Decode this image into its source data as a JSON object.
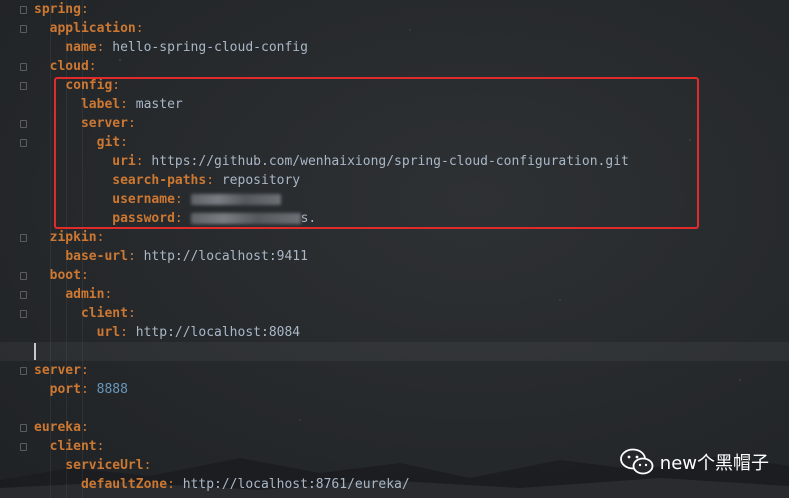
{
  "yaml": {
    "spring_key": "spring",
    "application_key": "application",
    "name_key": "name",
    "name_value": "hello-spring-cloud-config",
    "cloud_key": "cloud",
    "config_key": "config",
    "label_key": "label",
    "label_value": "master",
    "server_key": "server",
    "git_key": "git",
    "uri_key": "uri",
    "uri_value": "https://github.com/wenhaixiong/spring-cloud-configuration.git",
    "search_paths_key": "search-paths",
    "search_paths_value": "repository",
    "username_key": "username",
    "password_key": "password",
    "password_tail": "s.",
    "zipkin_key": "zipkin",
    "base_url_key": "base-url",
    "base_url_value": "http://localhost:9411",
    "boot_key": "boot",
    "admin_key": "admin",
    "client_key": "client",
    "url_key": "url",
    "url_value": "http://localhost:8084",
    "server_root_key": "server",
    "port_key": "port",
    "port_value": "8888",
    "eureka_key": "eureka",
    "eureka_client_key": "client",
    "service_url_key": "serviceUrl",
    "default_zone_key": "defaultZone",
    "default_zone_value": "http://localhost:8761/eureka/"
  },
  "watermark": {
    "text": "new个黑帽子",
    "icon": "wechat-icon"
  },
  "colors": {
    "highlight_box": "#e02b2b",
    "key": "#cc7832",
    "value": "#a9b7c6",
    "number": "#6897bb"
  }
}
